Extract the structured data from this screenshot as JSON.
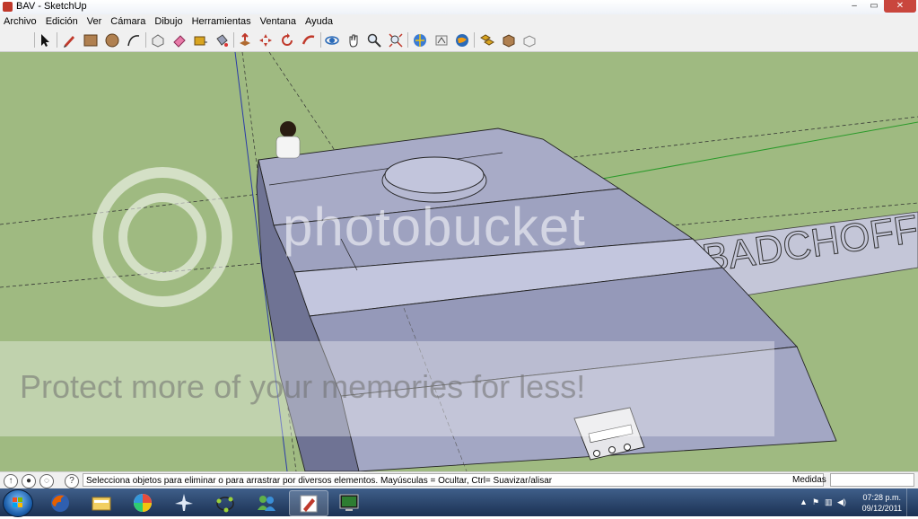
{
  "window": {
    "title": "BAV - SketchUp"
  },
  "window_controls": {
    "minimize": "–",
    "maximize": "▭",
    "close": "✕"
  },
  "menu": [
    "Archivo",
    "Edición",
    "Ver",
    "Cámara",
    "Dibujo",
    "Herramientas",
    "Ventana",
    "Ayuda"
  ],
  "toolbar": {
    "tools": [
      "select-icon",
      "pencil-icon",
      "rectangle-icon",
      "circle-icon",
      "arc-icon",
      "make-component-icon",
      "eraser-icon",
      "tape-measure-icon",
      "paint-bucket-icon",
      "push-pull-icon",
      "move-icon",
      "rotate-icon",
      "follow-me-icon",
      "orbit-icon",
      "pan-icon",
      "zoom-icon",
      "zoom-extents-icon",
      "3d-warehouse-icon",
      "share-model-icon",
      "google-earth-icon",
      "components-icon",
      "get-photo-icon",
      "sandbox-icon"
    ]
  },
  "viewport": {
    "text3d": "BADCHOFF",
    "watermark_brand": "photobucket",
    "watermark_tagline": "Protect more of your memories for less!"
  },
  "statusbar": {
    "hint": "Selecciona objetos para eliminar o para arrastrar por diversos elementos. Mayúsculas = Ocultar, Ctrl= Suavizar/alisar",
    "measure_label": "Medidas",
    "measure_value": ""
  },
  "taskbar": {
    "apps": [
      "firefox-icon",
      "explorer-icon",
      "picasa-icon",
      "airplane-icon",
      "geogebra-icon",
      "messenger-icon",
      "sketchup-icon",
      "monitor-icon"
    ],
    "active_app": "sketchup-icon",
    "time": "07:28 p.m.",
    "date": "09/12/2011"
  },
  "colors": {
    "ground": "#9fba81",
    "face": "#a3a7c4",
    "face_dark": "#8d91b0",
    "taskbar": "#1b3153"
  }
}
